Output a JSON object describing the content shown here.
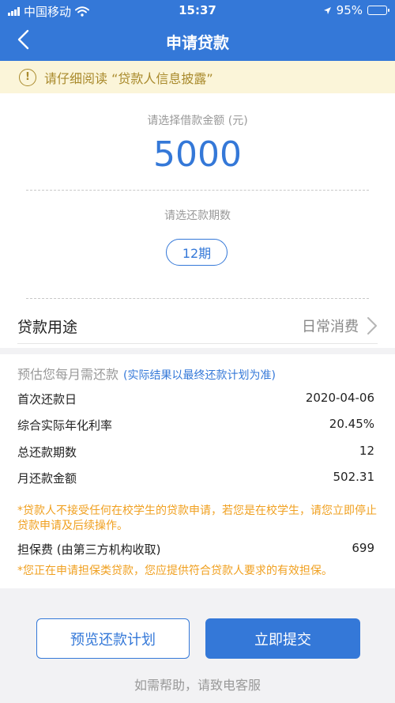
{
  "status_bar": {
    "carrier": "中国移动",
    "time": "15:37",
    "battery": "95%",
    "battery_level": 0.95
  },
  "nav": {
    "title": "申请贷款",
    "back_icon": "chevron-left-icon"
  },
  "notice": {
    "icon": "exclamation-circle-icon",
    "text": "请仔细阅读 “贷款人信息披露”"
  },
  "loan": {
    "amount_label": "请选择借款金额 (元)",
    "amount": "5000",
    "term_label": "请选还款期数",
    "term": "12期",
    "purpose_label": "贷款用途",
    "purpose_value": "日常消费"
  },
  "estimate": {
    "title": "预估您每月需还款",
    "note": "(实际结果以最终还款计划为准)",
    "rows": [
      {
        "label": "首次还款日",
        "value": "2020-04-06"
      },
      {
        "label": "综合实际年化利率",
        "value": "20.45%"
      },
      {
        "label": "总还款期数",
        "value": "12"
      },
      {
        "label": "月还款金额",
        "value": "502.31"
      }
    ],
    "warning_student": "*贷款人不接受任何在校学生的贷款申请，若您是在校学生，请您立即停止贷款申请及后续操作。",
    "guarantee_label": "担保费 (由第三方机构收取)",
    "guarantee_value": "699",
    "warning_guarantee": "*您正在申请担保类贷款，您应提供符合贷款人要求的有效担保。"
  },
  "actions": {
    "preview": "预览还款计划",
    "submit": "立即提交"
  },
  "footer": {
    "help": "如需帮助，请致电客服"
  },
  "colors": {
    "primary": "#3478d8",
    "warning": "#f0a020",
    "notice_bg": "#fbf5d9"
  }
}
